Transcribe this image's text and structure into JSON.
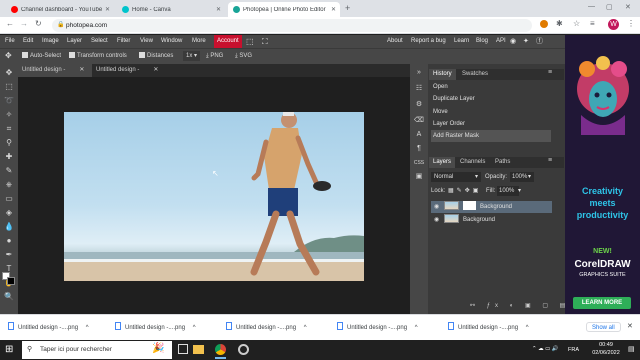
{
  "browser": {
    "tabs": [
      {
        "label": "Channel dashboard - YouTube S",
        "icon": "youtube-icon",
        "color": "#ff0000"
      },
      {
        "label": "Home - Canva",
        "icon": "canva-icon",
        "color": "#00c4cc"
      },
      {
        "label": "Photopea | Online Photo Editor",
        "icon": "photopea-icon",
        "color": "#18a497"
      }
    ],
    "url": "photopea.com"
  },
  "menubar": {
    "items": [
      "File",
      "Edit",
      "Image",
      "Layer",
      "Select",
      "Filter",
      "View",
      "Window",
      "More"
    ],
    "account": "Account",
    "right_links": [
      "About",
      "Report a bug",
      "Learn",
      "Blog",
      "API"
    ]
  },
  "options": {
    "auto_select": "Auto-Select",
    "transform_controls": "Transform controls",
    "distances": "Distances",
    "zoom": "1x",
    "png": "PNG",
    "svg": "SVG"
  },
  "doc_tabs": [
    "Untitled design -",
    "Untitled design -"
  ],
  "history": {
    "tabs": [
      "History",
      "Swatches"
    ],
    "items": [
      "Open",
      "Duplicate Layer",
      "Move",
      "Layer Order",
      "Add Raster Mask"
    ],
    "selected_index": 4
  },
  "layers": {
    "tabs": [
      "Layers",
      "Channels",
      "Paths"
    ],
    "blend_mode": "Normal",
    "opacity_label": "Opacity:",
    "opacity": "100%",
    "lock_label": "Lock:",
    "fill_label": "Fill:",
    "fill": "100%",
    "items": [
      "Background",
      "Background"
    ]
  },
  "ad": {
    "line1": "Creativity",
    "line2": "meets",
    "line3": "productivity",
    "new": "NEW!",
    "product": "CorelDRAW",
    "suite": "GRAPHICS SUITE",
    "cta": "LEARN MORE"
  },
  "downloads": {
    "items": [
      "Untitled design -....png",
      "Untitled design -....png",
      "Untitled design -....png",
      "Untitled design -....png",
      "Untitled design -....png"
    ],
    "show_all": "Show all"
  },
  "taskbar": {
    "search_placeholder": "Taper ici pour rechercher",
    "language": "FRA",
    "time": "00:49",
    "date": "02/06/2022"
  }
}
